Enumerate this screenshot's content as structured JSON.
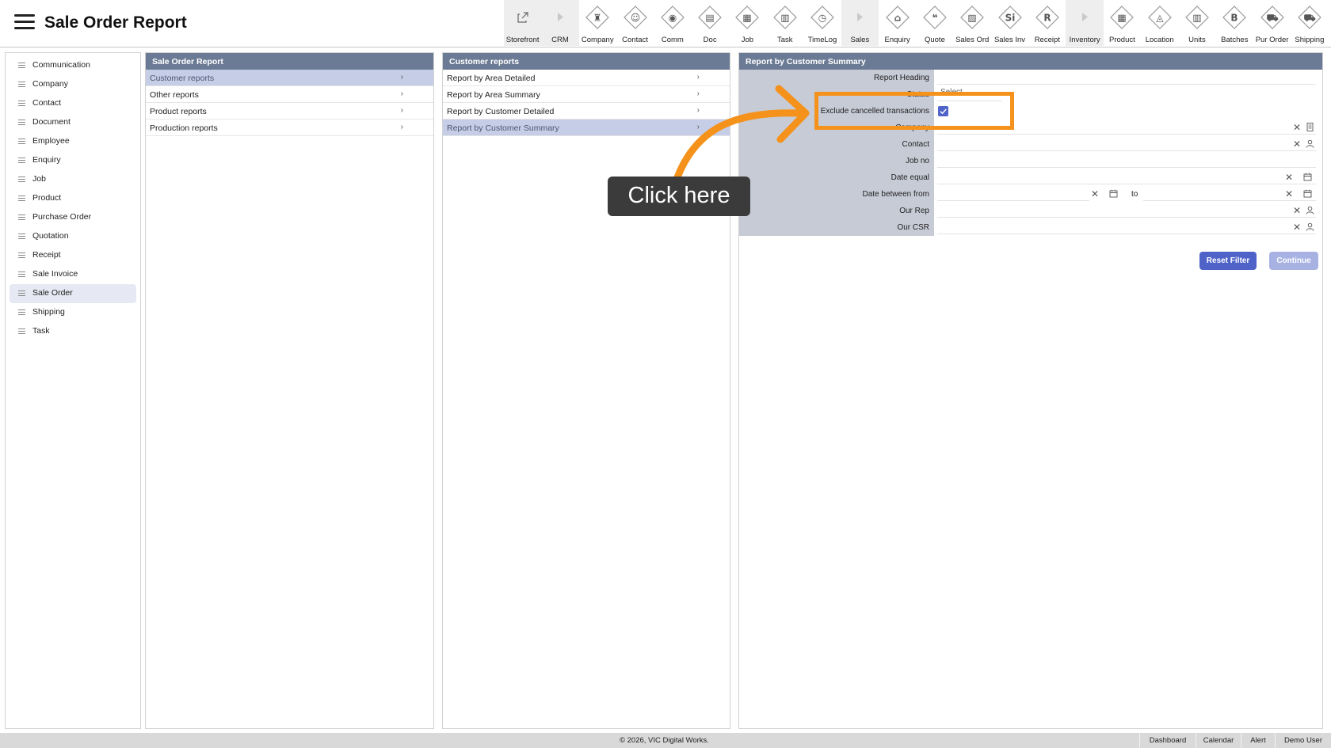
{
  "header": {
    "title": "Sale Order Report"
  },
  "toolbar": [
    {
      "label": "Storefront",
      "icon": "external-link-icon",
      "kind": "plain",
      "shade": true
    },
    {
      "label": "CRM",
      "icon": "caret-right-icon",
      "kind": "caret",
      "shade": true
    },
    {
      "label": "Company",
      "icon": "company-icon",
      "kind": "diamond",
      "glyph": "♜"
    },
    {
      "label": "Contact",
      "icon": "contact-icon",
      "kind": "diamond",
      "glyph": "☺"
    },
    {
      "label": "Comm",
      "icon": "comm-icon",
      "kind": "diamond",
      "glyph": "◉"
    },
    {
      "label": "Doc",
      "icon": "doc-icon",
      "kind": "diamond",
      "glyph": "▤"
    },
    {
      "label": "Job",
      "icon": "job-icon",
      "kind": "diamond",
      "glyph": "▦"
    },
    {
      "label": "Task",
      "icon": "task-icon",
      "kind": "diamond",
      "glyph": "▥"
    },
    {
      "label": "TimeLog",
      "icon": "clock-icon",
      "kind": "diamond",
      "glyph": "◷"
    },
    {
      "label": "Sales",
      "icon": "caret-right-icon",
      "kind": "caret",
      "shade": true
    },
    {
      "label": "Enquiry",
      "icon": "enquiry-icon",
      "kind": "diamond",
      "glyph": "⌂"
    },
    {
      "label": "Quote",
      "icon": "quote-icon",
      "kind": "diamond",
      "glyph": "❝"
    },
    {
      "label": "Sales Ord",
      "icon": "sales-order-icon",
      "kind": "diamond",
      "glyph": "▨"
    },
    {
      "label": "Sales Inv",
      "icon": "sales-invoice-icon",
      "kind": "diamond",
      "glyph": "Si"
    },
    {
      "label": "Receipt",
      "icon": "receipt-icon",
      "kind": "diamond",
      "glyph": "R"
    },
    {
      "label": "Inventory",
      "icon": "caret-right-icon",
      "kind": "caret",
      "shade": true
    },
    {
      "label": "Product",
      "icon": "product-icon",
      "kind": "diamond",
      "glyph": "▦"
    },
    {
      "label": "Location",
      "icon": "location-icon",
      "kind": "diamond",
      "glyph": "◬"
    },
    {
      "label": "Units",
      "icon": "units-icon",
      "kind": "diamond",
      "glyph": "▥"
    },
    {
      "label": "Batches",
      "icon": "batches-icon",
      "kind": "diamond",
      "glyph": "B"
    },
    {
      "label": "Pur Order",
      "icon": "cart-icon",
      "kind": "diamond",
      "glyph": "⛟"
    },
    {
      "label": "Shipping",
      "icon": "truck-icon",
      "kind": "diamond",
      "glyph": "⛟"
    }
  ],
  "sidebar": {
    "items": [
      {
        "label": "Communication"
      },
      {
        "label": "Company"
      },
      {
        "label": "Contact"
      },
      {
        "label": "Document"
      },
      {
        "label": "Employee"
      },
      {
        "label": "Enquiry"
      },
      {
        "label": "Job"
      },
      {
        "label": "Product"
      },
      {
        "label": "Purchase Order"
      },
      {
        "label": "Quotation"
      },
      {
        "label": "Receipt"
      },
      {
        "label": "Sale Invoice"
      },
      {
        "label": "Sale Order",
        "active": true
      },
      {
        "label": "Shipping"
      },
      {
        "label": "Task"
      }
    ]
  },
  "panel1": {
    "title": "Sale Order Report",
    "items": [
      {
        "label": "Customer reports",
        "selected": true
      },
      {
        "label": "Other reports"
      },
      {
        "label": "Product reports"
      },
      {
        "label": "Production reports"
      }
    ]
  },
  "panel2": {
    "title": "Customer reports",
    "items": [
      {
        "label": "Report by Area Detailed"
      },
      {
        "label": "Report by Area Summary"
      },
      {
        "label": "Report by Customer Detailed"
      },
      {
        "label": "Report by Customer Summary",
        "selected": true
      }
    ]
  },
  "form": {
    "title": "Report by Customer Summary",
    "fields": {
      "report_heading": {
        "label": "Report Heading"
      },
      "status": {
        "label": "Status",
        "value": "Select"
      },
      "exclude_cancelled": {
        "label": "Exclude cancelled transactions",
        "checked": true
      },
      "company": {
        "label": "Company"
      },
      "contact": {
        "label": "Contact"
      },
      "job_no": {
        "label": "Job no"
      },
      "date_equal": {
        "label": "Date equal"
      },
      "date_between": {
        "label": "Date between from",
        "to_label": "to"
      },
      "our_rep": {
        "label": "Our Rep"
      },
      "our_csr": {
        "label": "Our CSR"
      }
    },
    "reset_label": "Reset Filter",
    "continue_label": "Continue"
  },
  "overlay": {
    "callout": "Click here",
    "accent": "#f5921c"
  },
  "footer": {
    "copyright": "© 2026, VIC Digital Works.",
    "links": [
      "Dashboard",
      "Calendar",
      "Alert",
      "Demo User"
    ]
  }
}
